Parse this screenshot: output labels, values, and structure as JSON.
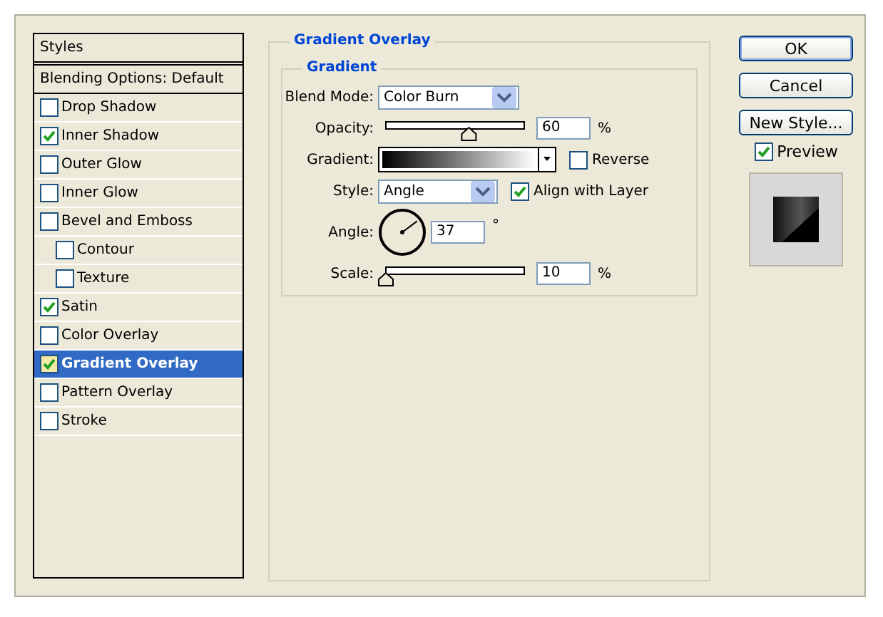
{
  "styles_panel": {
    "title": "Styles",
    "blending_options": "Blending Options: Default",
    "items": [
      {
        "label": "Drop Shadow",
        "checked": false,
        "selected": false
      },
      {
        "label": "Inner Shadow",
        "checked": true,
        "selected": false
      },
      {
        "label": "Outer Glow",
        "checked": false,
        "selected": false
      },
      {
        "label": "Inner Glow",
        "checked": false,
        "selected": false
      },
      {
        "label": "Bevel and Emboss",
        "checked": false,
        "selected": false,
        "children": [
          {
            "label": "Contour",
            "checked": false,
            "selected": false
          },
          {
            "label": "Texture",
            "checked": false,
            "selected": false
          }
        ]
      },
      {
        "label": "Satin",
        "checked": true,
        "selected": false
      },
      {
        "label": "Color Overlay",
        "checked": false,
        "selected": false
      },
      {
        "label": "Gradient Overlay",
        "checked": true,
        "selected": true
      },
      {
        "label": "Pattern Overlay",
        "checked": false,
        "selected": false
      },
      {
        "label": "Stroke",
        "checked": false,
        "selected": false
      }
    ]
  },
  "gradient_overlay": {
    "title": "Gradient Overlay",
    "section": "Gradient",
    "blend_mode": {
      "label": "Blend Mode:",
      "value": "Color Burn"
    },
    "opacity": {
      "label": "Opacity:",
      "value": "60",
      "unit": "%",
      "level": 0.6
    },
    "gradient": {
      "label": "Gradient:"
    },
    "reverse": {
      "label": "Reverse",
      "checked": false
    },
    "style": {
      "label": "Style:",
      "value": "Angle"
    },
    "align_with_layer": {
      "label": "Align with Layer",
      "checked": true
    },
    "angle": {
      "label": "Angle:",
      "value": "37",
      "unit": "°"
    },
    "scale": {
      "label": "Scale:",
      "value": "10",
      "unit": "%",
      "level": 0.0
    }
  },
  "buttons": [
    {
      "label": "OK",
      "kind": "default"
    },
    {
      "label": "Cancel",
      "kind": "normal"
    },
    {
      "label": "New Style...",
      "kind": "normal"
    }
  ],
  "preview": {
    "label": "Preview",
    "checked": true
  }
}
